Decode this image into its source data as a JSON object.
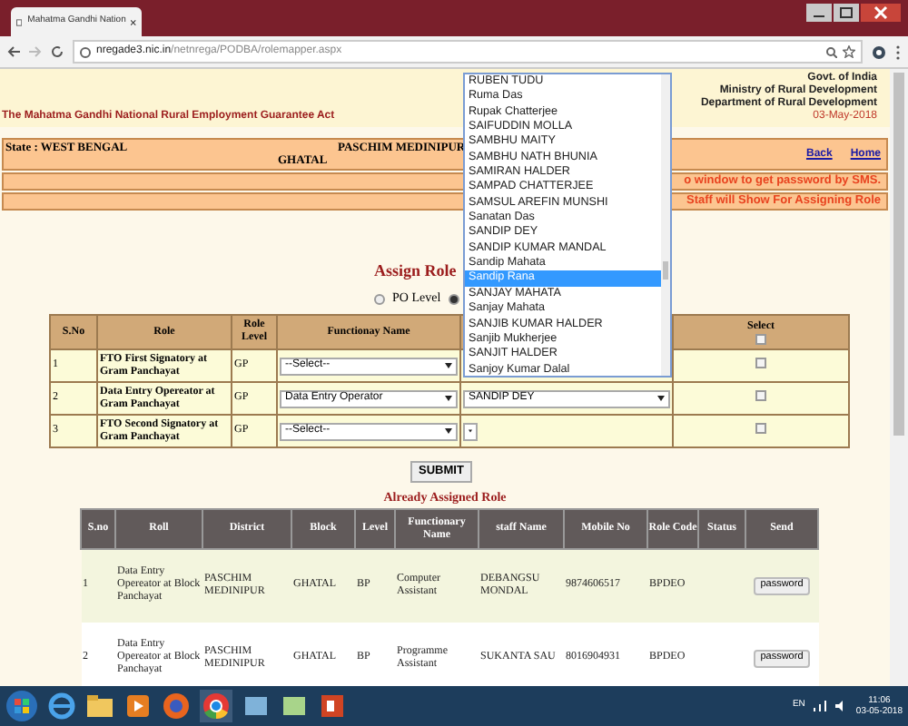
{
  "browser": {
    "tab_title": "Mahatma Gandhi Nation",
    "url_host": "nregade3.nic.in",
    "url_path": "/netnrega/PODBA/rolemapper.aspx"
  },
  "header": {
    "govt_lines": [
      "Govt. of India",
      "Ministry of Rural Development",
      "Department of Rural Development"
    ],
    "act_title": "The Mahatma Gandhi National Rural Employment Guarantee Act",
    "date": "03-May-2018"
  },
  "location_bar": {
    "state": "State : WEST BENGAL",
    "district": "PASCHIM MEDINIPUR",
    "block": "GHATAL",
    "links": [
      "Back",
      "Home"
    ]
  },
  "notices": [
    "o window to get password by SMS.",
    "Staff will Show For Assigning Role"
  ],
  "assign_title": "Assign Role",
  "level_options": [
    {
      "label": "PO Level",
      "selected": false
    },
    {
      "selected": true
    }
  ],
  "role_table": {
    "columns": [
      "S.No",
      "Role",
      "Role Level",
      "Functionay Name",
      "Select"
    ],
    "select_all_checked": false,
    "rows": [
      {
        "sno": "1",
        "role": "FTO First Signatory at Gram Panchayat",
        "level": "GP",
        "functionary": "--Select--",
        "checked": false
      },
      {
        "sno": "2",
        "role": "Data Entry Opereator at Gram Panchayat",
        "level": "GP",
        "functionary": "Data Entry Operator",
        "staff": "SANDIP DEY",
        "checked": false
      },
      {
        "sno": "3",
        "role": "FTO Second Signatory at Gram Panchayat",
        "level": "GP",
        "functionary": "--Select--",
        "checked": false
      }
    ]
  },
  "submit": "SUBMIT",
  "assigned_title": "Already Assigned Role",
  "assigned_table": {
    "columns": [
      "S.no",
      "Roll",
      "District",
      "Block",
      "Level",
      "Functionary Name",
      "staff Name",
      "Mobile No",
      "Role Code",
      "Status",
      "Send"
    ],
    "rows": [
      {
        "cells": [
          "1",
          "Data Entry Opereator at Block Panchayat",
          "PASCHIM MEDINIPUR",
          "GHATAL",
          "BP",
          "Computer Assistant",
          "DEBANGSU MONDAL",
          "9874606517",
          "BPDEO",
          ""
        ],
        "button": "password"
      },
      {
        "cells": [
          "2",
          "Data Entry Opereator at Block Panchayat",
          "PASCHIM MEDINIPUR",
          "GHATAL",
          "BP",
          "Programme Assistant",
          "SUKANTA SAU",
          "8016904931",
          "BPDEO",
          ""
        ],
        "button": "password"
      }
    ]
  },
  "dropdown": {
    "options": [
      {
        "label": "RUBEN TUDU",
        "selected": false
      },
      {
        "label": "Ruma Das",
        "selected": false
      },
      {
        "label": "Rupak Chatterjee",
        "selected": false
      },
      {
        "label": "SAIFUDDIN MOLLA",
        "selected": false
      },
      {
        "label": "SAMBHU MAITY",
        "selected": false
      },
      {
        "label": "SAMBHU NATH BHUNIA",
        "selected": false
      },
      {
        "label": "SAMIRAN HALDER",
        "selected": false
      },
      {
        "label": "SAMPAD CHATTERJEE",
        "selected": false
      },
      {
        "label": "SAMSUL AREFIN MUNSHI",
        "selected": false
      },
      {
        "label": "Sanatan Das",
        "selected": false
      },
      {
        "label": "SANDIP DEY",
        "selected": false
      },
      {
        "label": "SANDIP KUMAR MANDAL",
        "selected": false
      },
      {
        "label": "Sandip Mahata",
        "selected": false
      },
      {
        "label": "Sandip Rana",
        "selected": true
      },
      {
        "label": "SANJAY MAHATA",
        "selected": false
      },
      {
        "label": "Sanjay Mahata",
        "selected": false
      },
      {
        "label": "SANJIB KUMAR HALDER",
        "selected": false
      },
      {
        "label": "Sanjib Mukherjee",
        "selected": false
      },
      {
        "label": "SANJIT HALDER",
        "selected": false
      },
      {
        "label": "Sanjoy Kumar Dalal",
        "selected": false
      }
    ]
  },
  "taskbar": {
    "language": "EN",
    "time": "11:06",
    "date": "03-05-2018"
  }
}
